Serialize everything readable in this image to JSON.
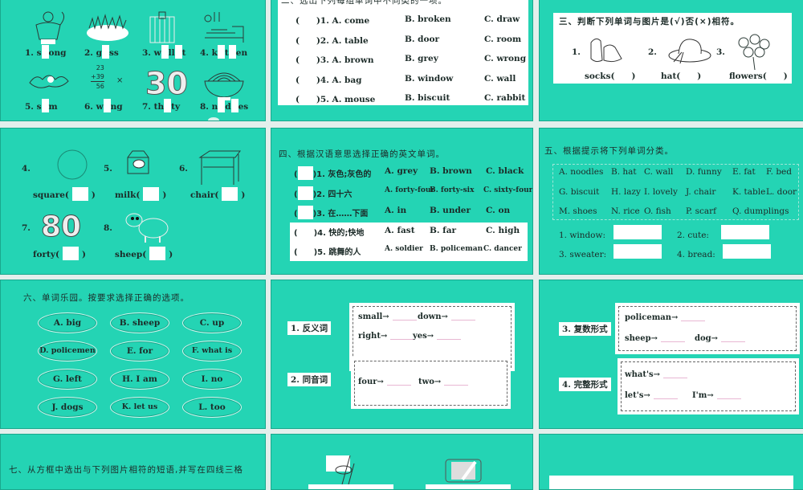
{
  "colors": {
    "slide": "#24d4b4",
    "gap": "#e3efec",
    "blank": "#ffffff"
  },
  "s1": {
    "items": [
      {
        "parts": [
          "1. s",
          "ong"
        ],
        "icon": "strong-man-icon"
      },
      {
        "parts": [
          "2. g",
          "ss"
        ],
        "icon": "grass-icon"
      },
      {
        "parts": [
          "3. w",
          "ll",
          "t"
        ],
        "icon": "wallet-icon"
      },
      {
        "parts": [
          "4. k",
          "t",
          "en"
        ],
        "icon": "kitchen-icon"
      },
      {
        "parts": [
          "5. s",
          "m"
        ],
        "icon": "swim-icon"
      },
      {
        "parts": [
          "6. w",
          "ng"
        ],
        "icon": "wrong-sum-icon"
      },
      {
        "parts": [
          "7. th",
          "ty"
        ],
        "icon": "thirty-icon"
      },
      {
        "parts": [
          "8. n",
          "d",
          "es"
        ],
        "icon": "noodles-icon"
      }
    ],
    "sum": [
      "23",
      "+39",
      "56",
      "×"
    ]
  },
  "s2": {
    "title": "二、选出下列每组单词中不同类的一项。",
    "rows": [
      {
        "q": "(　　)1. A. come",
        "b": "B. broken",
        "c": "C. draw"
      },
      {
        "q": "(　　)2. A. table",
        "b": "B. door",
        "c": "C. room"
      },
      {
        "q": "(　　)3. A. brown",
        "b": "B. grey",
        "c": "C. wrong"
      },
      {
        "q": "(　　)4. A. bag",
        "b": "B. window",
        "c": "C. wall"
      },
      {
        "q": "(　　)5. A. mouse",
        "b": "B. biscuit",
        "c": "C. rabbit"
      }
    ]
  },
  "s3": {
    "title": "三、判断下列单词与图片是(√)否(×)相符。",
    "items": [
      {
        "num": "1.",
        "word": "socks(　　)",
        "icon": "shoes-icon"
      },
      {
        "num": "2.",
        "word": "hat(　　)",
        "icon": "hat-icon"
      },
      {
        "num": "3.",
        "word": "flowers(　　)",
        "icon": "flowers-icon"
      }
    ]
  },
  "s4": {
    "items": [
      {
        "num": "4.",
        "word": "square(",
        "close": ")",
        "icon": "circle-icon"
      },
      {
        "num": "5.",
        "word": "milk(",
        "close": ")",
        "icon": "milk-carton-icon"
      },
      {
        "num": "6.",
        "word": "chair(",
        "close": ")",
        "icon": "table-icon"
      },
      {
        "num": "7.",
        "word": "forty(",
        "close": ")",
        "icon": "eighty-icon"
      },
      {
        "num": "8.",
        "word": "sheep(",
        "close": ")",
        "icon": "sheep-icon"
      }
    ]
  },
  "s5": {
    "title": "四、根据汉语意思选择正确的英文单词。",
    "rows": [
      {
        "open": "(",
        "q": ")1. 灰色;灰色的",
        "a": "A. grey",
        "b": "B. brown",
        "c": "C. black",
        "boxed": true
      },
      {
        "open": "(",
        "q": ")2. 四十六",
        "a": "A. forty-four",
        "b": "B. forty-six",
        "c": "C. sixty-four",
        "boxed": true
      },
      {
        "open": "(",
        "q": ")3. 在……下面",
        "a": "A. in",
        "b": "B. under",
        "c": "C. on",
        "boxed": true
      },
      {
        "open": "(",
        "q": "　　)4. 快的;快地",
        "a": "A. fast",
        "b": "B. far",
        "c": "C. high",
        "boxed": false
      },
      {
        "open": "(",
        "q": "　　)5. 跳舞的人",
        "a": "A. soldier",
        "b": "B. policeman",
        "c": "C. dancer",
        "boxed": false
      }
    ]
  },
  "s6": {
    "title": "五、根据提示将下列单词分类。",
    "words": [
      [
        "A. noodles",
        "B. hat",
        "C. wall",
        "D. funny",
        "E. fat",
        "F. bed"
      ],
      [
        "G. biscuit",
        "H. lazy",
        "I. lovely",
        "J. chair",
        "K. table",
        "L. door"
      ],
      [
        "M. shoes",
        "N. rice",
        "O. fish",
        "P. scarf",
        "Q. dumplings"
      ]
    ],
    "answers": [
      "1. window:",
      "2. cute:",
      "3. sweater:",
      "4. bread:"
    ]
  },
  "s7": {
    "title": "六、单词乐园。按要求选择正确的选项。",
    "options": [
      "A. big",
      "B. sheep",
      "C. up",
      "D. policemen",
      "E. for",
      "F. what is",
      "G. left",
      "H. I am",
      "I. no",
      "J. dogs",
      "K. let us",
      "L. too"
    ]
  },
  "s8": {
    "label1": "1. 反义词",
    "label2": "2. 同音词",
    "row1": [
      "small→",
      "down→"
    ],
    "row2": [
      "right→",
      "yes→"
    ],
    "row3": [
      "four→",
      "two→"
    ]
  },
  "s9": {
    "label3": "3. 复数形式",
    "label4": "4. 完整形式",
    "row1": [
      "policeman→"
    ],
    "row2": [
      "sheep→",
      "dog→"
    ],
    "row3": [
      "what's→"
    ],
    "row4": [
      "let's→",
      "I'm→"
    ]
  },
  "s10": {
    "title": "七、从方框中选出与下列图片相符的短语,并写在四线三格"
  }
}
